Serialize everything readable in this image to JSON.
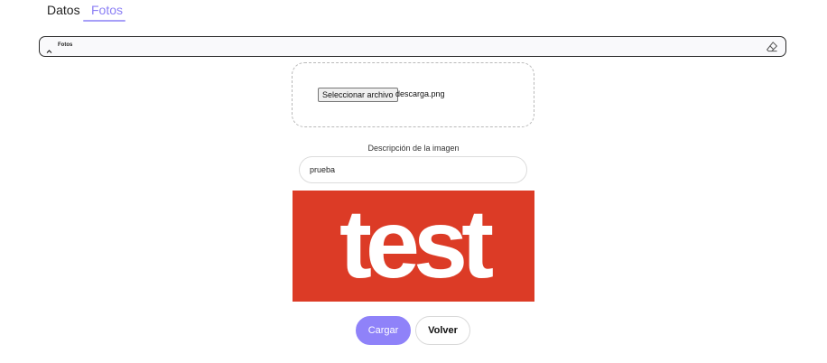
{
  "tabs": [
    {
      "label": "Datos",
      "active": false
    },
    {
      "label": "Fotos",
      "active": true
    }
  ],
  "accordion": {
    "title": "Fotos",
    "expanded": true
  },
  "upload": {
    "button_label": "Seleccionar archivo",
    "file_name": "descarga.png"
  },
  "description": {
    "label": "Descripción de la imagen",
    "value": "prueba"
  },
  "preview": {
    "text": "test",
    "background": "#dc3b26"
  },
  "actions": {
    "submit_label": "Cargar",
    "back_label": "Volver"
  },
  "colors": {
    "accent": "#8f82f9",
    "tab_active": "#8b7ff5"
  }
}
